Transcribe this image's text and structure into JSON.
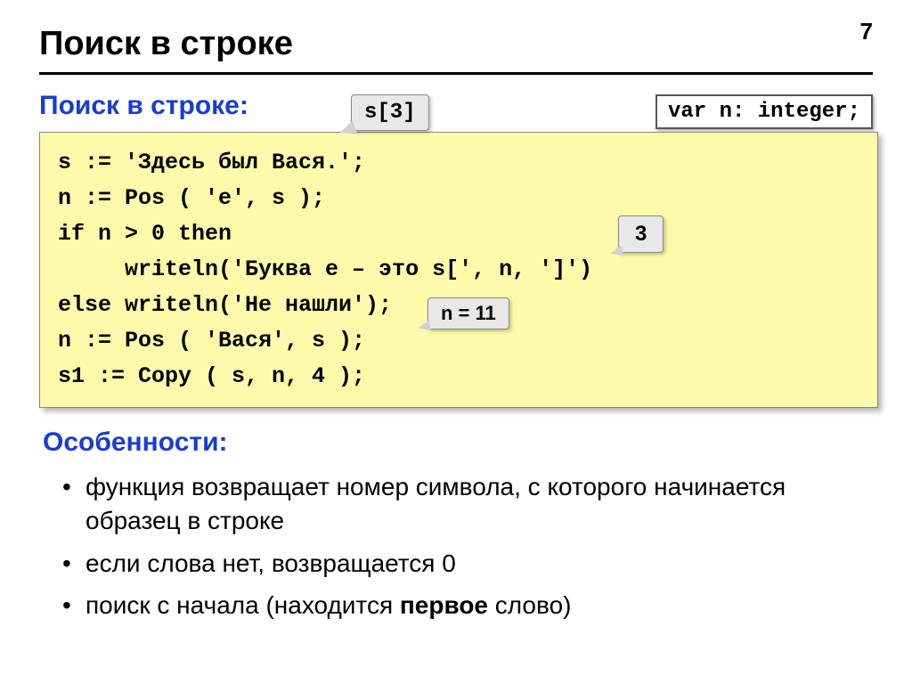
{
  "page_number": "7",
  "title": "Поиск в строке",
  "subtitle": "Поиск в строке:",
  "callout_s3": "s[3]",
  "var_declaration": "var n: integer;",
  "code": "s := 'Здесь был Вася.';\nn := Pos ( 'е', s );\nif n > 0 then\n     writeln('Буква е – это s[', n, ']')\nelse writeln('Не нашли');\nn := Pos ( 'Вася', s );\ns1 := Copy ( s, n, 4 );",
  "callout_3": "3",
  "callout_n11": "n = 11",
  "features_title": "Особенности:",
  "features": {
    "item1": "функция возвращает номер символа, с которого начинается образец в строке",
    "item2": "если слова нет, возвращается 0",
    "item3_prefix": "поиск с начала (находится ",
    "item3_bold": "первое",
    "item3_suffix": " слово)"
  }
}
